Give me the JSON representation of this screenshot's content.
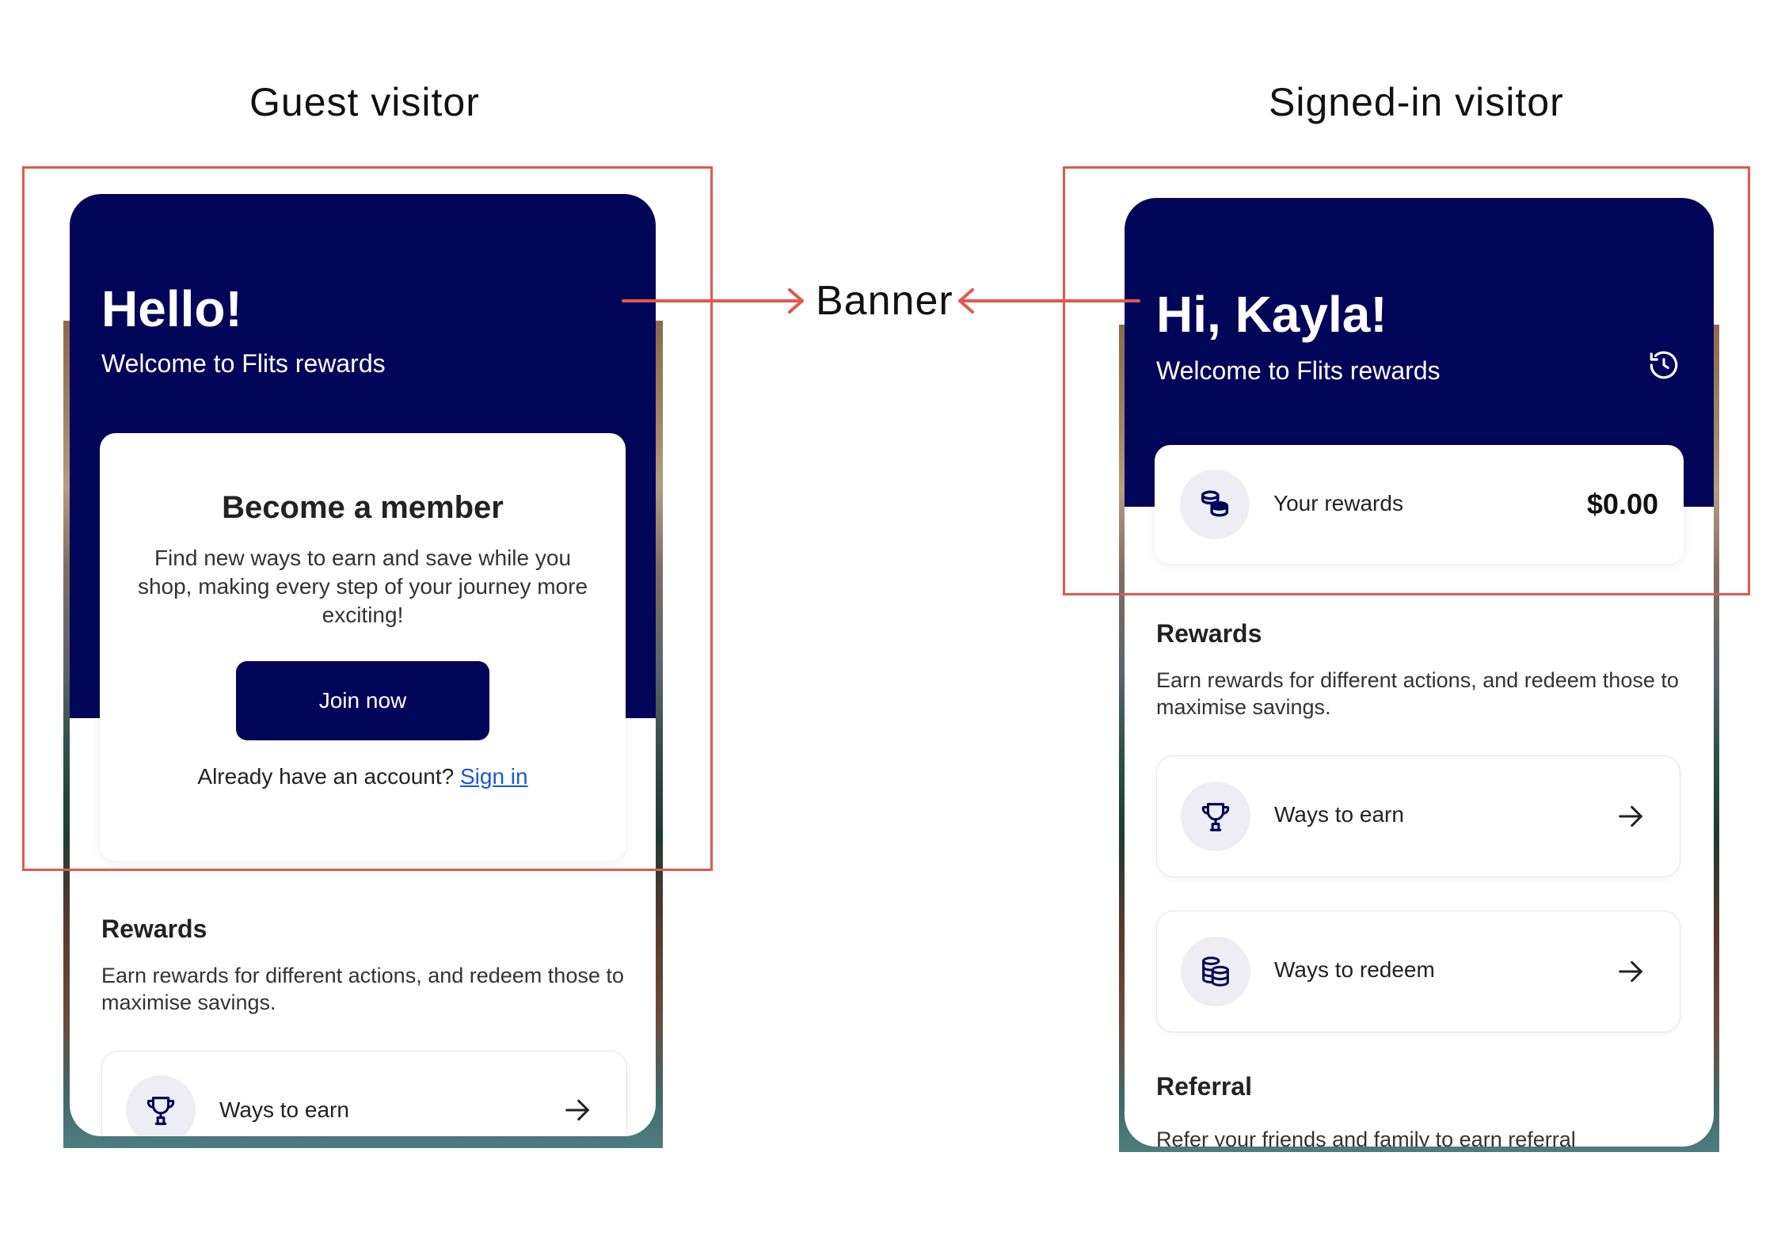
{
  "captions": {
    "guest": "Guest visitor",
    "signed_in": "Signed-in visitor",
    "banner": "Banner"
  },
  "colors": {
    "navy": "#020659",
    "annotation_red": "#e4574c",
    "link_blue": "#1a56db",
    "icon_bg": "#ededf3"
  },
  "guest": {
    "greeting": "Hello!",
    "welcome": "Welcome to Flits rewards",
    "member_card": {
      "title": "Become a member",
      "description": "Find new ways to earn and save while you shop, making every step of your journey more exciting!",
      "join_label": "Join now",
      "account_prompt": "Already have an account?",
      "signin_label": "Sign in"
    },
    "rewards": {
      "title": "Rewards",
      "description": "Earn rewards for different actions, and redeem those to maximise savings."
    },
    "rows": [
      {
        "label": "Ways to earn",
        "icon": "trophy-icon"
      }
    ]
  },
  "signed_in": {
    "greeting": "Hi, Kayla!",
    "welcome": "Welcome to Flits rewards",
    "history_icon": "history-icon",
    "rewards_card": {
      "label": "Your rewards",
      "amount": "$0.00",
      "icon": "coins-icon"
    },
    "rewards": {
      "title": "Rewards",
      "description": "Earn rewards for different actions, and redeem those to maximise savings."
    },
    "rows": [
      {
        "label": "Ways to earn",
        "icon": "trophy-icon"
      },
      {
        "label": "Ways to redeem",
        "icon": "coin-stack-icon"
      }
    ],
    "referral": {
      "title": "Referral",
      "description": "Refer your friends and family to earn referral"
    }
  }
}
